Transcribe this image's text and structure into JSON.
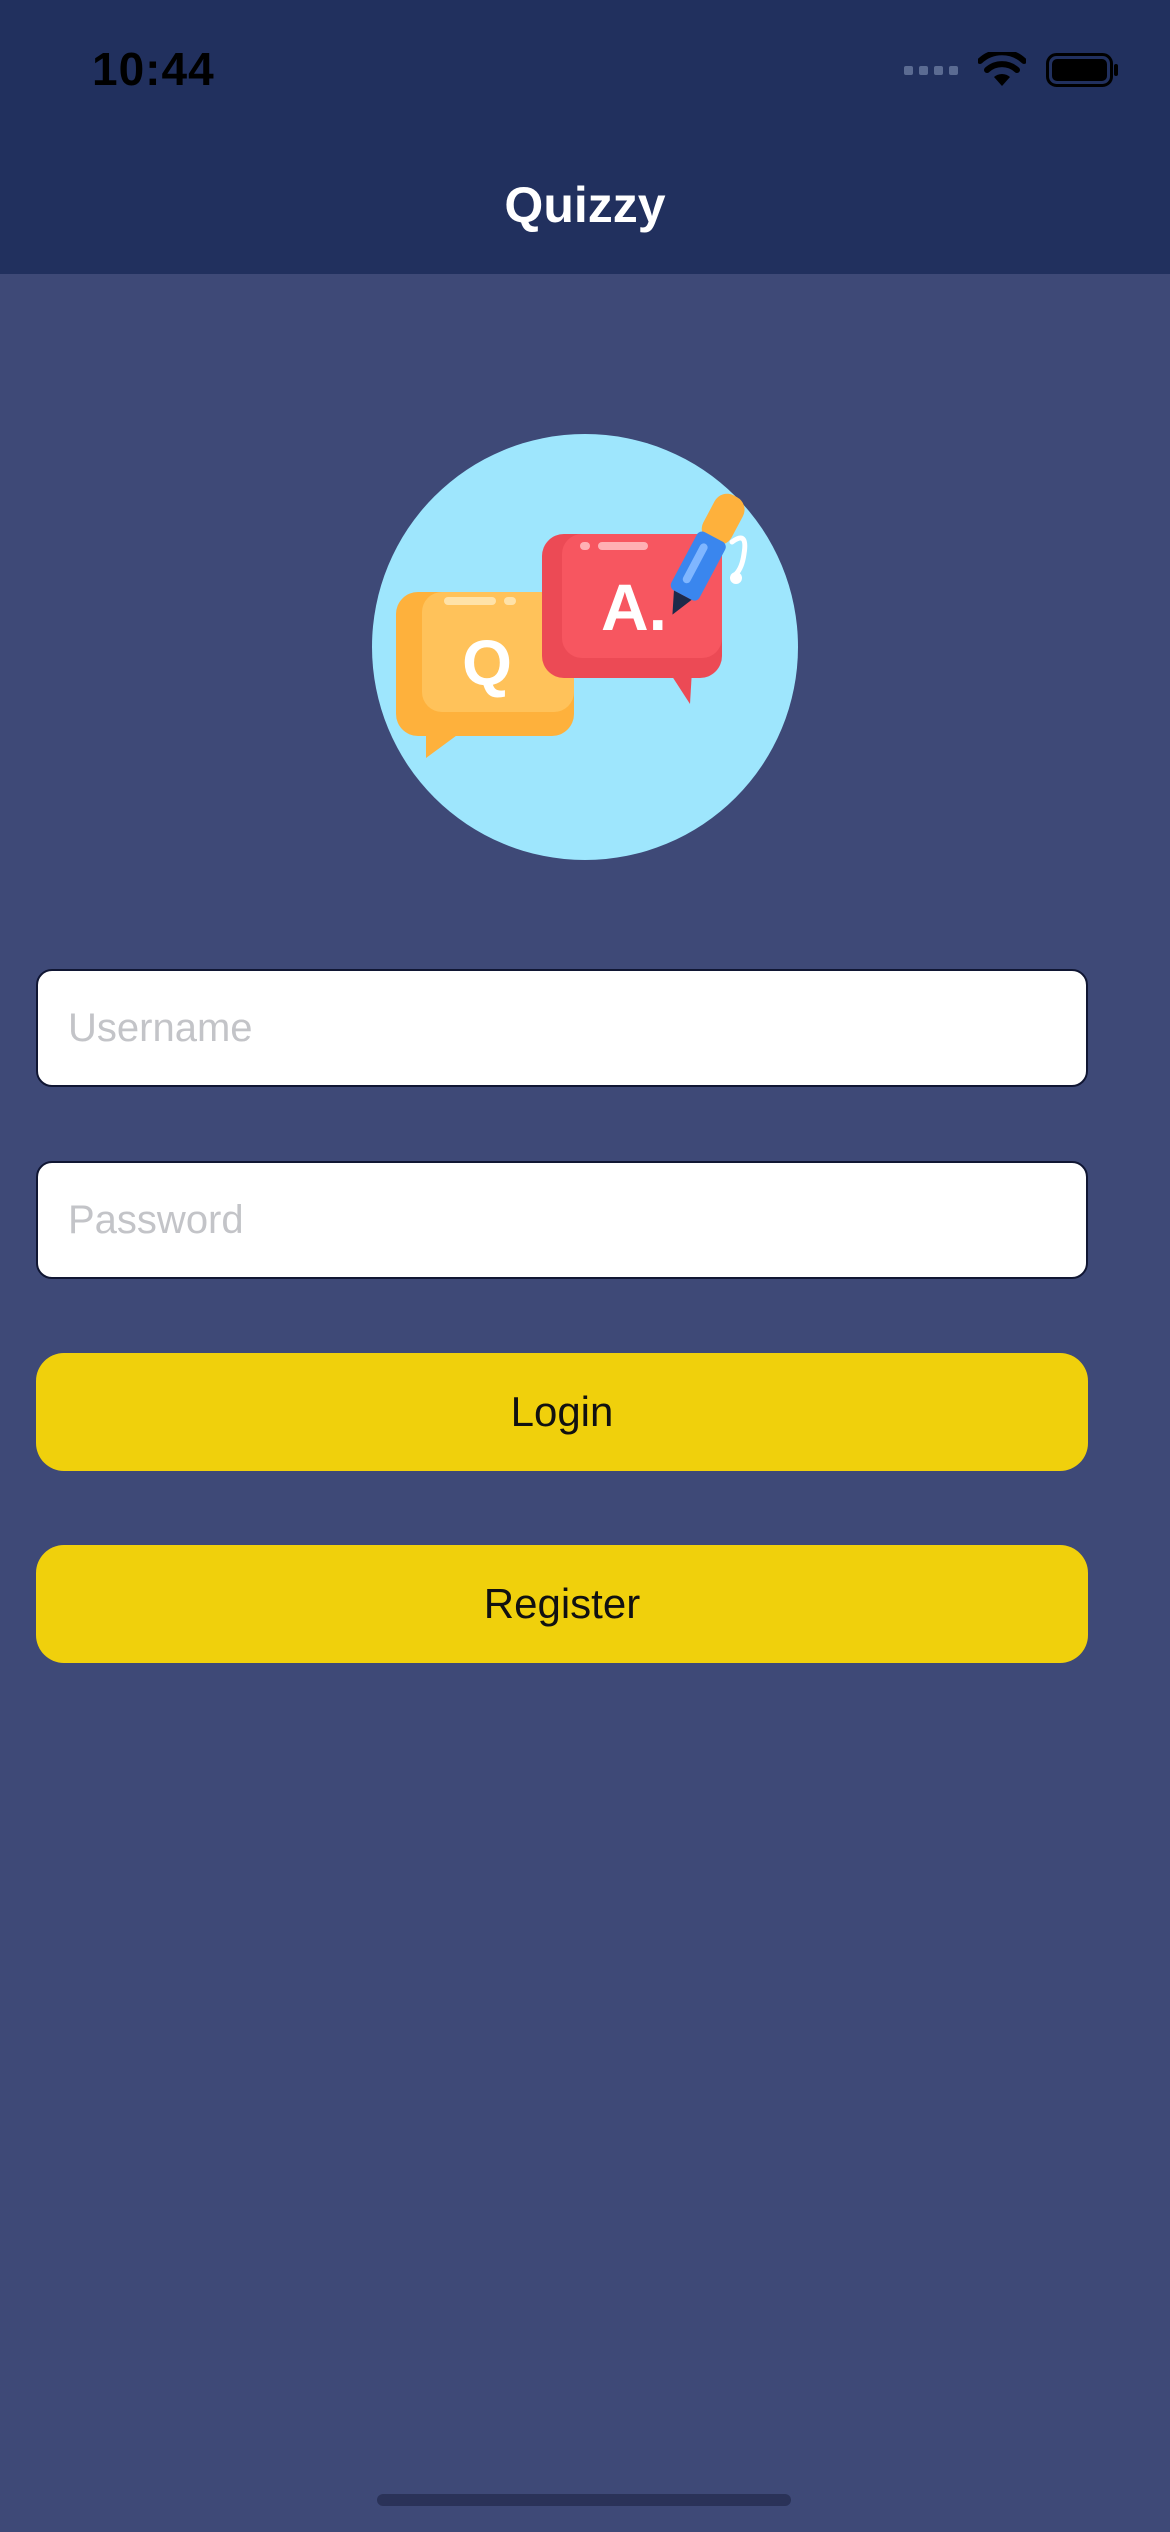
{
  "status_bar": {
    "time": "10:44"
  },
  "nav": {
    "title": "Quizzy"
  },
  "logo": {
    "question_letter": "Q",
    "answer_letter": "A."
  },
  "form": {
    "username": {
      "value": "",
      "placeholder": "Username"
    },
    "password": {
      "value": "",
      "placeholder": "Password"
    }
  },
  "buttons": {
    "login_label": "Login",
    "register_label": "Register"
  },
  "colors": {
    "background": "#3e4977",
    "nav_bar": "#21305e",
    "button": "#f0d00c",
    "logo_circle": "#9ee6fd"
  },
  "icons": [
    "wifi-icon",
    "battery-icon",
    "cellular-signal-icon",
    "quiz-chat-logo-icon",
    "pen-icon"
  ]
}
